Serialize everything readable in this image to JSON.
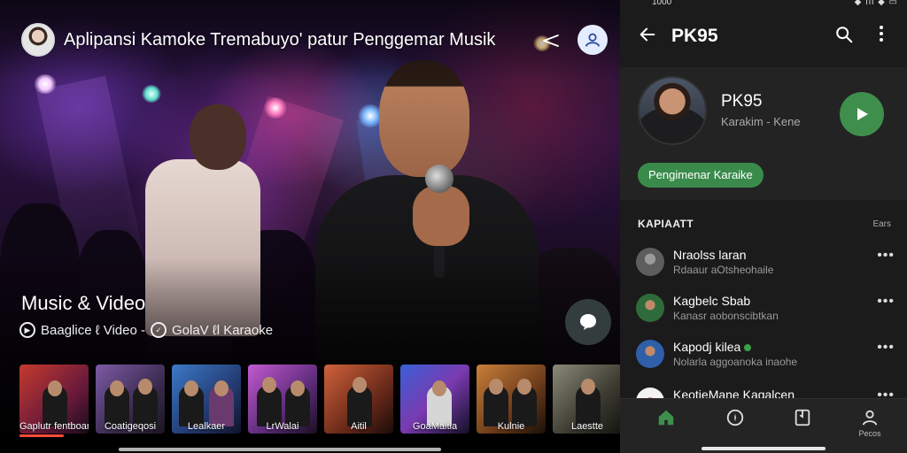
{
  "hero": {
    "app_title": "Aplipansi Kamoke Tremabuyo' patur Penggemar Musik",
    "section_title": "Music & Video",
    "subtitle_left": "Baaglice ℓ Video -",
    "subtitle_right": "GolaV ℓl Karaoke",
    "thumbnails": [
      {
        "caption": "Gaplutr fentboantd"
      },
      {
        "caption": "Coatigeqosi"
      },
      {
        "caption": "Lealkaer"
      },
      {
        "caption": "LrWalai"
      },
      {
        "caption": "Aitil"
      },
      {
        "caption": "GoaMaltla"
      },
      {
        "caption": "Kulnie"
      },
      {
        "caption": "Laestte"
      }
    ]
  },
  "phone": {
    "status_time": "1000",
    "status_icons": "◆ ıll ◆ ▭",
    "title": "PK95",
    "profile": {
      "name": "PK95",
      "sub": "Karakim - Kene",
      "chip": "Pengimenar  Karaike"
    },
    "list_header": "KAPIAATT",
    "list_header_right": "Ears",
    "rows": [
      {
        "title": "Nraolss laran",
        "sub": "Rdaaur aOtsheohaile",
        "online": false
      },
      {
        "title": "Kagbelc Sbab",
        "sub": "Kanasr aobonscibtkan",
        "online": false
      },
      {
        "title": "Kapodj kilea",
        "sub": "Nolarla aggoanoka inaohe",
        "online": true
      },
      {
        "title": "KeotieMane Kagalcen",
        "sub": "",
        "online": false
      }
    ],
    "nav_last_label": "Pecos"
  },
  "colors": {
    "accent_green": "#3f8f4c",
    "progress_red": "#ff4b3a"
  }
}
